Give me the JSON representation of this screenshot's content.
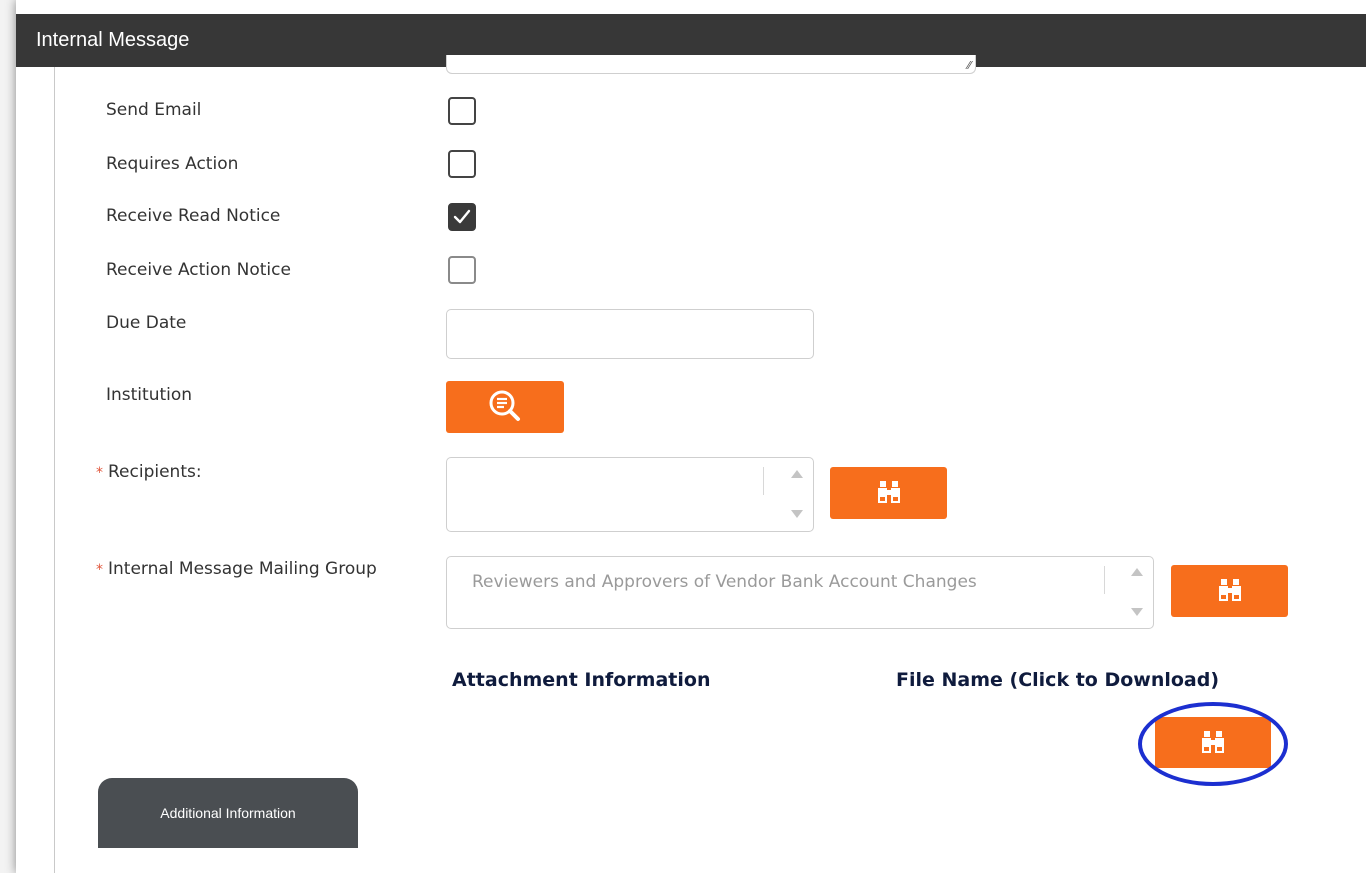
{
  "window": {
    "title": "Internal Message"
  },
  "form": {
    "send_email_label": "Send Email",
    "requires_action_label": "Requires Action",
    "receive_read_notice_label": "Receive Read Notice",
    "receive_action_notice_label": "Receive Action Notice",
    "due_date_label": "Due Date",
    "due_date_value": "",
    "institution_label": "Institution",
    "recipients_label": "Recipients:",
    "recipients_required_mark": "*",
    "mailing_group_label": "Internal Message Mailing Group",
    "mailing_group_required_mark": "*",
    "mailing_group_value": "Reviewers and Approvers of Vendor Bank Account Changes",
    "checkboxes": {
      "send_email": false,
      "requires_action": false,
      "receive_read_notice": true,
      "receive_action_notice": false
    }
  },
  "attachments": {
    "info_heading": "Attachment Information",
    "file_name_heading": "File Name (Click to Download)"
  },
  "tabs": {
    "additional_info": "Additional Information"
  },
  "colors": {
    "accent": "#f76e1c",
    "titlebar": "#373737",
    "heading": "#0f1b3d",
    "highlight_ring": "#1c2fd0",
    "required": "#e0563b"
  },
  "icons": {
    "institution_button": "search-document-icon",
    "lookup_buttons": "binoculars-icon"
  }
}
